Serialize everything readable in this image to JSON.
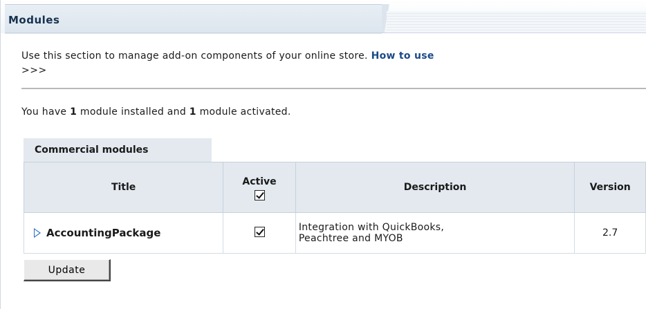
{
  "header": {
    "title": "Modules"
  },
  "intro": {
    "text": "Use this section to manage add-on components of your online store.",
    "link_text": "How to use",
    "arrows": ">>>"
  },
  "summary": {
    "prefix": "You have",
    "installed_count": "1",
    "middle": "module installed and",
    "activated_count": "1",
    "suffix": "module activated."
  },
  "section": {
    "tab_label": "Commercial modules"
  },
  "table": {
    "headers": {
      "title": "Title",
      "active": "Active",
      "description": "Description",
      "version": "Version"
    },
    "select_all_checked": true,
    "rows": [
      {
        "title": "AccountingPackage",
        "active": true,
        "description_line1": "Integration with QuickBooks,",
        "description_line2": "Peachtree and MYOB",
        "version": "2.7"
      }
    ]
  },
  "actions": {
    "update_label": "Update"
  }
}
